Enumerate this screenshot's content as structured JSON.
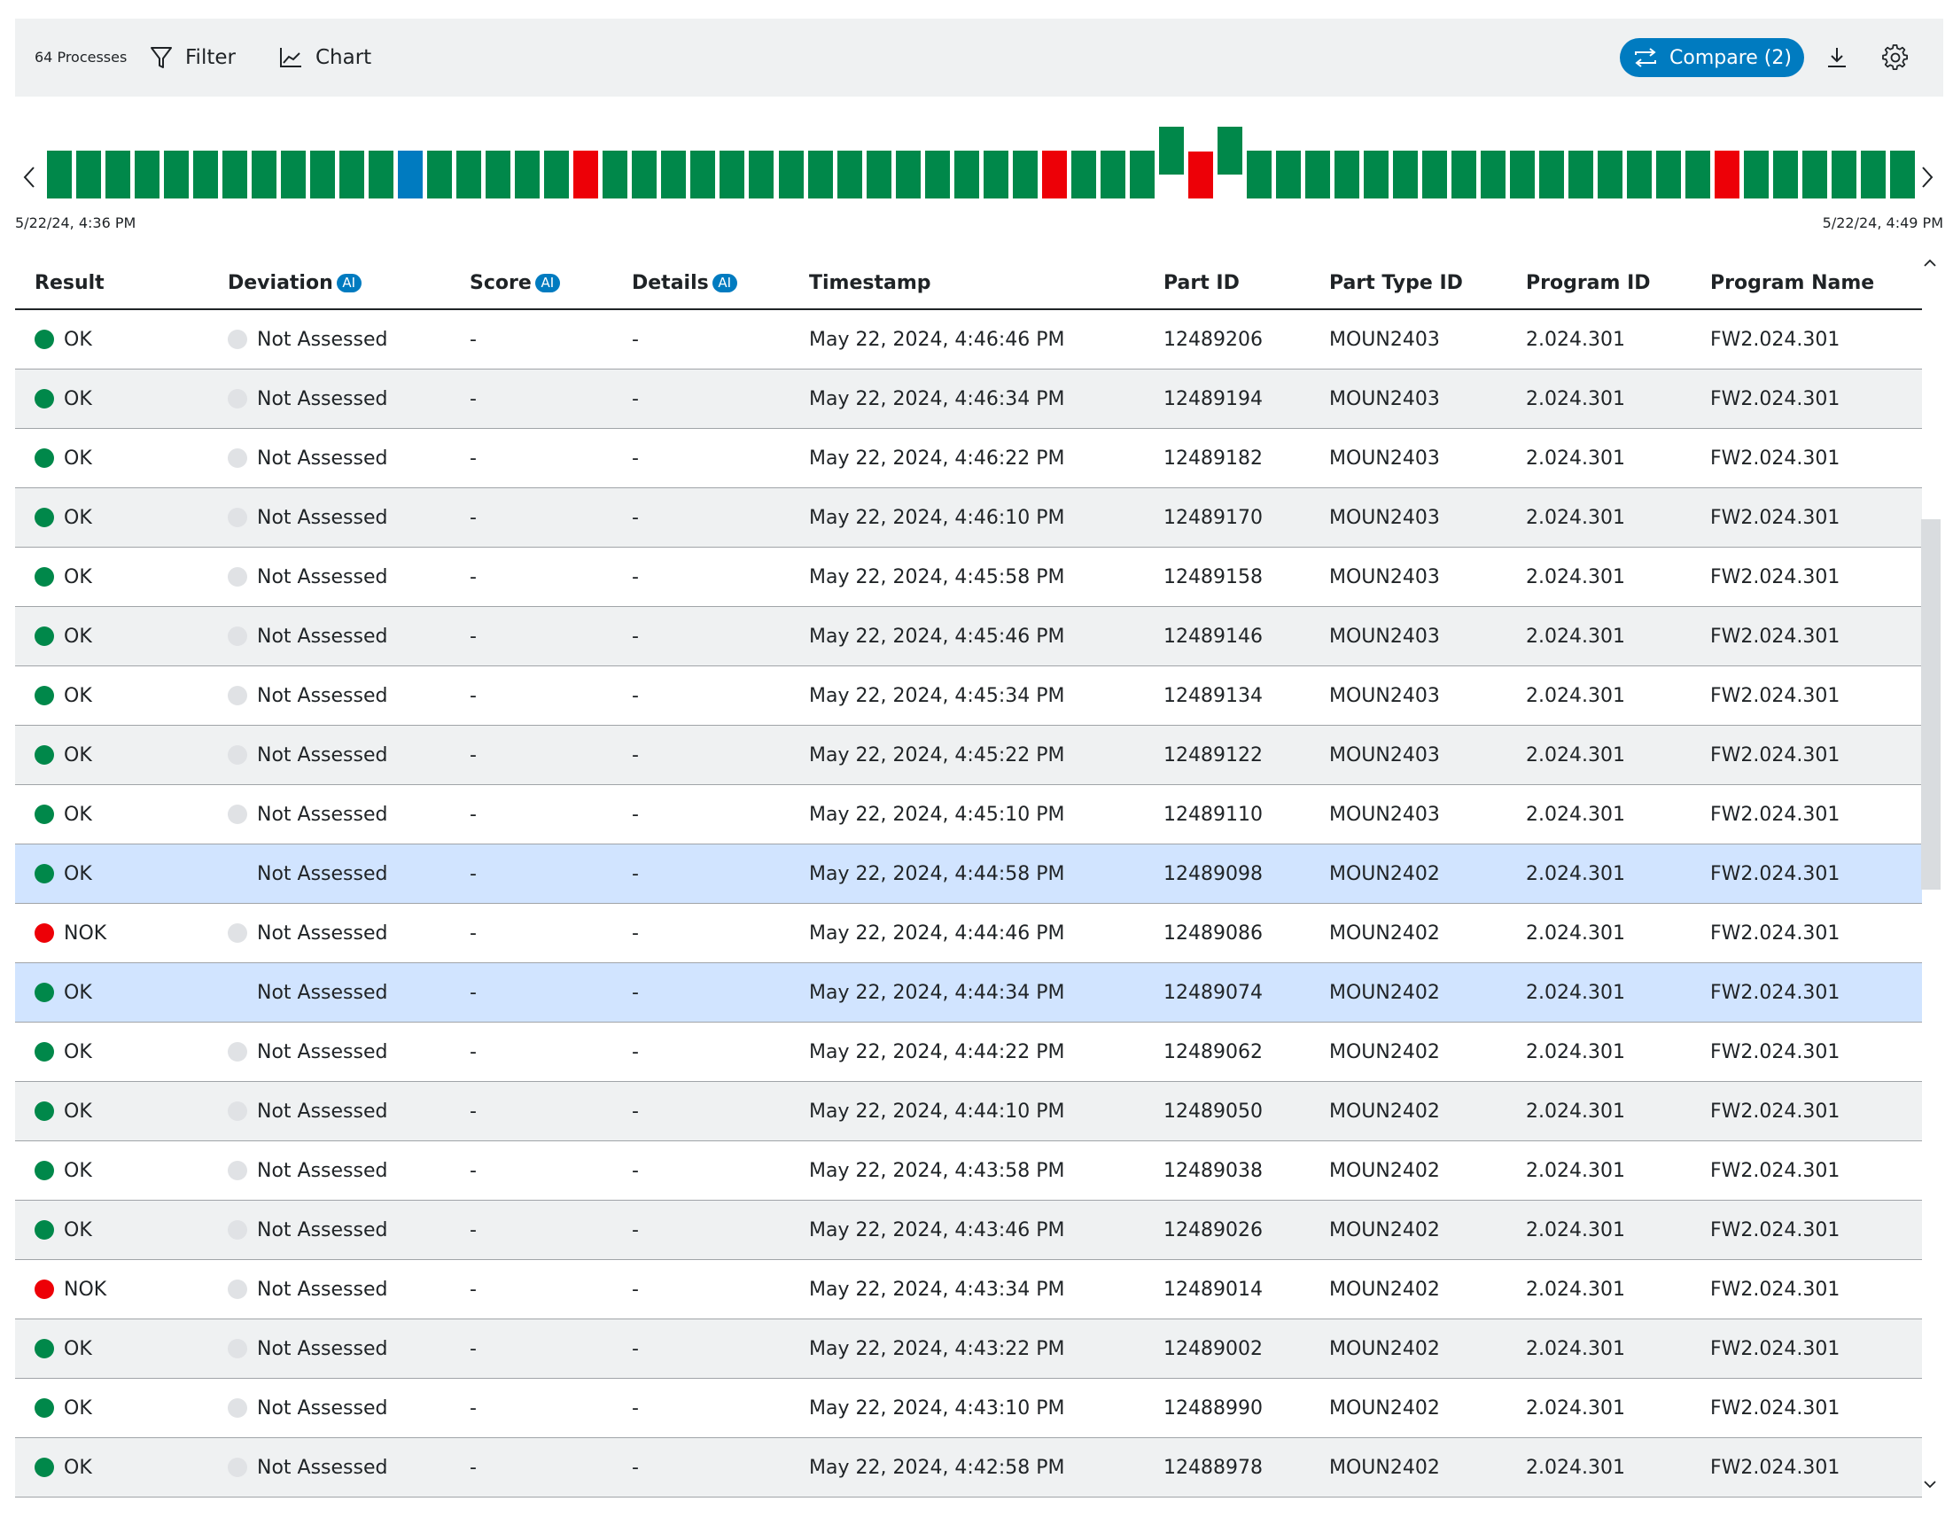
{
  "toolbar": {
    "process_count": "64 Processes",
    "filter_label": "Filter",
    "chart_label": "Chart",
    "compare_label": "Compare (2)",
    "icons": {
      "filter": "filter-icon",
      "chart": "chart-icon",
      "compare": "compare-icon",
      "download": "download-icon",
      "settings": "gear-icon"
    }
  },
  "timeline": {
    "start_label": "5/22/24, 4:36 PM",
    "end_label": "5/22/24, 4:49 PM",
    "colors": {
      "ok": "#00884a",
      "nok": "#ed0007",
      "selected": "#007bc0"
    },
    "bars": [
      "ok",
      "ok",
      "ok",
      "ok",
      "ok",
      "ok",
      "ok",
      "ok",
      "ok",
      "ok",
      "ok",
      "ok",
      "selected",
      "ok",
      "ok",
      "ok",
      "ok",
      "ok",
      "nok",
      "ok",
      "ok",
      "ok",
      "ok",
      "ok",
      "ok",
      "ok",
      "ok",
      "ok",
      "ok",
      "ok",
      "ok",
      "ok",
      "ok",
      "ok",
      "nok",
      "ok",
      "ok",
      "ok",
      "ok-raised",
      "nok-low",
      "ok-raised",
      "ok",
      "ok",
      "ok",
      "ok",
      "ok",
      "ok",
      "ok",
      "ok",
      "ok",
      "ok",
      "ok",
      "ok",
      "ok",
      "ok",
      "ok",
      "ok",
      "nok",
      "ok",
      "ok",
      "ok",
      "ok",
      "ok",
      "ok"
    ]
  },
  "table": {
    "headers": {
      "result": "Result",
      "deviation": "Deviation",
      "score": "Score",
      "details": "Details",
      "timestamp": "Timestamp",
      "part_id": "Part ID",
      "part_type_id": "Part Type ID",
      "program_id": "Program ID",
      "program_name": "Program Name",
      "ai_badge": "AI"
    },
    "rows": [
      {
        "result": "OK",
        "status": "ok",
        "deviation": "Not Assessed",
        "score": "-",
        "details": "-",
        "timestamp": "May 22, 2024, 4:46:46 PM",
        "part_id": "12489206",
        "part_type_id": "MOUN2403",
        "program_id": "2.024.301",
        "program_name": "FW2.024.301",
        "selected": false
      },
      {
        "result": "OK",
        "status": "ok",
        "deviation": "Not Assessed",
        "score": "-",
        "details": "-",
        "timestamp": "May 22, 2024, 4:46:34 PM",
        "part_id": "12489194",
        "part_type_id": "MOUN2403",
        "program_id": "2.024.301",
        "program_name": "FW2.024.301",
        "selected": false
      },
      {
        "result": "OK",
        "status": "ok",
        "deviation": "Not Assessed",
        "score": "-",
        "details": "-",
        "timestamp": "May 22, 2024, 4:46:22 PM",
        "part_id": "12489182",
        "part_type_id": "MOUN2403",
        "program_id": "2.024.301",
        "program_name": "FW2.024.301",
        "selected": false
      },
      {
        "result": "OK",
        "status": "ok",
        "deviation": "Not Assessed",
        "score": "-",
        "details": "-",
        "timestamp": "May 22, 2024, 4:46:10 PM",
        "part_id": "12489170",
        "part_type_id": "MOUN2403",
        "program_id": "2.024.301",
        "program_name": "FW2.024.301",
        "selected": false
      },
      {
        "result": "OK",
        "status": "ok",
        "deviation": "Not Assessed",
        "score": "-",
        "details": "-",
        "timestamp": "May 22, 2024, 4:45:58 PM",
        "part_id": "12489158",
        "part_type_id": "MOUN2403",
        "program_id": "2.024.301",
        "program_name": "FW2.024.301",
        "selected": false
      },
      {
        "result": "OK",
        "status": "ok",
        "deviation": "Not Assessed",
        "score": "-",
        "details": "-",
        "timestamp": "May 22, 2024, 4:45:46 PM",
        "part_id": "12489146",
        "part_type_id": "MOUN2403",
        "program_id": "2.024.301",
        "program_name": "FW2.024.301",
        "selected": false
      },
      {
        "result": "OK",
        "status": "ok",
        "deviation": "Not Assessed",
        "score": "-",
        "details": "-",
        "timestamp": "May 22, 2024, 4:45:34 PM",
        "part_id": "12489134",
        "part_type_id": "MOUN2403",
        "program_id": "2.024.301",
        "program_name": "FW2.024.301",
        "selected": false
      },
      {
        "result": "OK",
        "status": "ok",
        "deviation": "Not Assessed",
        "score": "-",
        "details": "-",
        "timestamp": "May 22, 2024, 4:45:22 PM",
        "part_id": "12489122",
        "part_type_id": "MOUN2403",
        "program_id": "2.024.301",
        "program_name": "FW2.024.301",
        "selected": false
      },
      {
        "result": "OK",
        "status": "ok",
        "deviation": "Not Assessed",
        "score": "-",
        "details": "-",
        "timestamp": "May 22, 2024, 4:45:10 PM",
        "part_id": "12489110",
        "part_type_id": "MOUN2403",
        "program_id": "2.024.301",
        "program_name": "FW2.024.301",
        "selected": false
      },
      {
        "result": "OK",
        "status": "ok",
        "deviation": "Not Assessed",
        "score": "-",
        "details": "-",
        "timestamp": "May 22, 2024, 4:44:58 PM",
        "part_id": "12489098",
        "part_type_id": "MOUN2402",
        "program_id": "2.024.301",
        "program_name": "FW2.024.301",
        "selected": true
      },
      {
        "result": "NOK",
        "status": "nok",
        "deviation": "Not Assessed",
        "score": "-",
        "details": "-",
        "timestamp": "May 22, 2024, 4:44:46 PM",
        "part_id": "12489086",
        "part_type_id": "MOUN2402",
        "program_id": "2.024.301",
        "program_name": "FW2.024.301",
        "selected": false
      },
      {
        "result": "OK",
        "status": "ok",
        "deviation": "Not Assessed",
        "score": "-",
        "details": "-",
        "timestamp": "May 22, 2024, 4:44:34 PM",
        "part_id": "12489074",
        "part_type_id": "MOUN2402",
        "program_id": "2.024.301",
        "program_name": "FW2.024.301",
        "selected": true
      },
      {
        "result": "OK",
        "status": "ok",
        "deviation": "Not Assessed",
        "score": "-",
        "details": "-",
        "timestamp": "May 22, 2024, 4:44:22 PM",
        "part_id": "12489062",
        "part_type_id": "MOUN2402",
        "program_id": "2.024.301",
        "program_name": "FW2.024.301",
        "selected": false
      },
      {
        "result": "OK",
        "status": "ok",
        "deviation": "Not Assessed",
        "score": "-",
        "details": "-",
        "timestamp": "May 22, 2024, 4:44:10 PM",
        "part_id": "12489050",
        "part_type_id": "MOUN2402",
        "program_id": "2.024.301",
        "program_name": "FW2.024.301",
        "selected": false
      },
      {
        "result": "OK",
        "status": "ok",
        "deviation": "Not Assessed",
        "score": "-",
        "details": "-",
        "timestamp": "May 22, 2024, 4:43:58 PM",
        "part_id": "12489038",
        "part_type_id": "MOUN2402",
        "program_id": "2.024.301",
        "program_name": "FW2.024.301",
        "selected": false
      },
      {
        "result": "OK",
        "status": "ok",
        "deviation": "Not Assessed",
        "score": "-",
        "details": "-",
        "timestamp": "May 22, 2024, 4:43:46 PM",
        "part_id": "12489026",
        "part_type_id": "MOUN2402",
        "program_id": "2.024.301",
        "program_name": "FW2.024.301",
        "selected": false
      },
      {
        "result": "NOK",
        "status": "nok",
        "deviation": "Not Assessed",
        "score": "-",
        "details": "-",
        "timestamp": "May 22, 2024, 4:43:34 PM",
        "part_id": "12489014",
        "part_type_id": "MOUN2402",
        "program_id": "2.024.301",
        "program_name": "FW2.024.301",
        "selected": false
      },
      {
        "result": "OK",
        "status": "ok",
        "deviation": "Not Assessed",
        "score": "-",
        "details": "-",
        "timestamp": "May 22, 2024, 4:43:22 PM",
        "part_id": "12489002",
        "part_type_id": "MOUN2402",
        "program_id": "2.024.301",
        "program_name": "FW2.024.301",
        "selected": false
      },
      {
        "result": "OK",
        "status": "ok",
        "deviation": "Not Assessed",
        "score": "-",
        "details": "-",
        "timestamp": "May 22, 2024, 4:43:10 PM",
        "part_id": "12488990",
        "part_type_id": "MOUN2402",
        "program_id": "2.024.301",
        "program_name": "FW2.024.301",
        "selected": false
      },
      {
        "result": "OK",
        "status": "ok",
        "deviation": "Not Assessed",
        "score": "-",
        "details": "-",
        "timestamp": "May 22, 2024, 4:42:58 PM",
        "part_id": "12488978",
        "part_type_id": "MOUN2402",
        "program_id": "2.024.301",
        "program_name": "FW2.024.301",
        "selected": false
      }
    ]
  }
}
